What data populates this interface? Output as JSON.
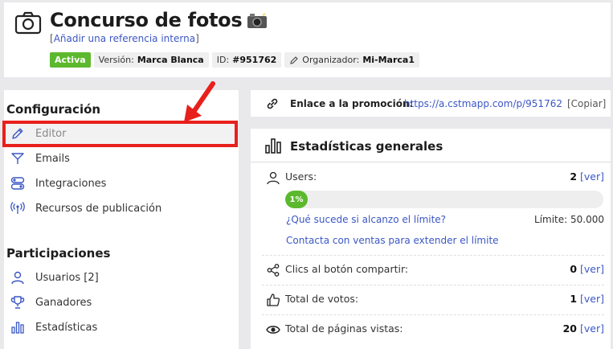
{
  "header": {
    "title": "Concurso de fotos",
    "ref_open": "[",
    "ref_link": "Añadir una referencia interna",
    "ref_close": "]",
    "badges": {
      "status": "Activa",
      "version_label": "Versión:",
      "version_value": "Marca Blanca",
      "id_label": "ID:",
      "id_value": "#951762",
      "organizer_label": "Organizador:",
      "organizer_value": "Mi-Marca1"
    }
  },
  "sidebar": {
    "config_title": "Configuración",
    "config_items": [
      {
        "label": "Editor",
        "icon": "pencil-icon"
      },
      {
        "label": "Emails",
        "icon": "send-icon"
      },
      {
        "label": "Integraciones",
        "icon": "toggles-icon"
      },
      {
        "label": "Recursos de publicación",
        "icon": "broadcast-icon"
      }
    ],
    "participations_title": "Participaciones",
    "participation_items": [
      {
        "label": "Usuarios [2]",
        "icon": "user-icon"
      },
      {
        "label": "Ganadores",
        "icon": "trophy-icon"
      },
      {
        "label": "Estadísticas",
        "icon": "bar-chart-icon"
      }
    ]
  },
  "promo": {
    "label": "Enlace a la promoción:",
    "url": "https://a.cstmapp.com/p/951762",
    "copy": "[Copiar]"
  },
  "stats": {
    "title": "Estadísticas generales",
    "users": {
      "label": "Users:",
      "value": "2",
      "link": "[ver]",
      "progress_text": "1%",
      "progress_fraction": 0.01
    },
    "limit_question": "¿Qué sucede si alcanzo el límite?",
    "limit_label": "Límite: 50.000",
    "contact_sales": "Contacta con ventas para extender el límite",
    "share_clicks": {
      "label": "Clics al botón compartir:",
      "value": "0",
      "link": "[ver]"
    },
    "votes": {
      "label": "Total de votos:",
      "value": "1",
      "link": "[ver]"
    },
    "page_views": {
      "label": "Total de páginas vistas:",
      "value": "20",
      "link": "[ver]"
    }
  },
  "colors": {
    "accent": "#3b57c4",
    "active_green": "#5cb82d",
    "highlight_red": "#e8201c"
  }
}
